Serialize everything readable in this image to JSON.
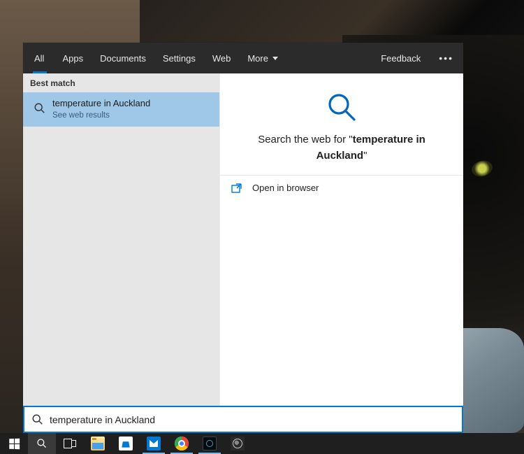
{
  "tabs": {
    "items": [
      "All",
      "Apps",
      "Documents",
      "Settings",
      "Web",
      "More"
    ],
    "active_index": 0,
    "feedback": "Feedback"
  },
  "left": {
    "best_match_hdr": "Best match",
    "result": {
      "title": "temperature in Auckland",
      "subtitle": "See web results"
    }
  },
  "right": {
    "prefix": "Search the web for \"",
    "query": "temperature in Auckland",
    "suffix": "\"",
    "open_label": "Open in browser"
  },
  "search": {
    "value": "temperature in Auckland"
  },
  "taskbar": {
    "items": [
      {
        "name": "start-button"
      },
      {
        "name": "search-button"
      },
      {
        "name": "task-view-button"
      },
      {
        "name": "file-explorer",
        "running": false
      },
      {
        "name": "microsoft-store",
        "running": false
      },
      {
        "name": "outlook",
        "running": true
      },
      {
        "name": "chrome",
        "running": true
      },
      {
        "name": "app-dark",
        "running": true
      },
      {
        "name": "app-generic",
        "running": false
      }
    ]
  }
}
